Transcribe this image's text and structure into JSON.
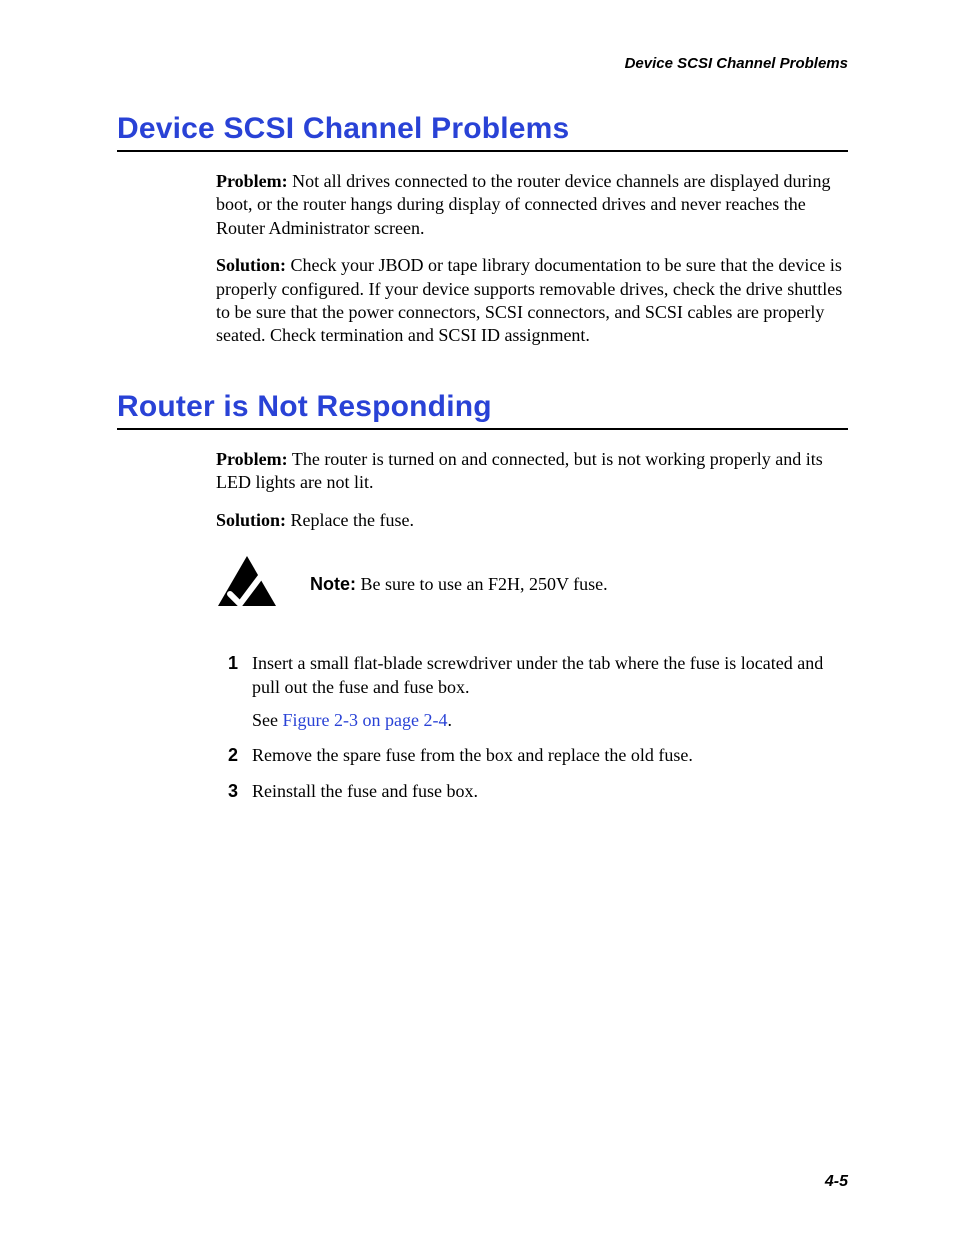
{
  "running_header": "Device SCSI Channel Problems",
  "section1": {
    "heading": "Device SCSI Channel Problems",
    "problem_label": "Problem:",
    "problem_text": " Not all drives connected to the router device channels are displayed during boot, or the router hangs during display of connected drives and never reaches the Router Administrator screen.",
    "solution_label": "Solution:",
    "solution_text": " Check your JBOD or tape library documentation to be sure that the device is properly configured. If your device supports removable drives, check the drive shuttles to be sure that the power connectors, SCSI connectors, and SCSI cables are properly seated. Check termination and SCSI ID assignment."
  },
  "section2": {
    "heading": "Router is Not Responding",
    "problem_label": "Problem:",
    "problem_text": " The router is turned on and connected, but is not working properly and its LED lights are not lit.",
    "solution_label": "Solution:",
    "solution_text": " Replace the fuse.",
    "note_label": "Note:",
    "note_text": " Be sure to use an F2H, 250V fuse.",
    "steps": [
      {
        "text": "Insert a small flat-blade screwdriver under the tab where the fuse is located and pull out the fuse and fuse box.",
        "see_prefix": "See ",
        "link": "Figure 2-3 on page 2-4",
        "see_suffix": "."
      },
      {
        "text": "Remove the spare fuse from the box and replace the old fuse."
      },
      {
        "text": "Reinstall the fuse and fuse box."
      }
    ]
  },
  "page_number": "4-5"
}
